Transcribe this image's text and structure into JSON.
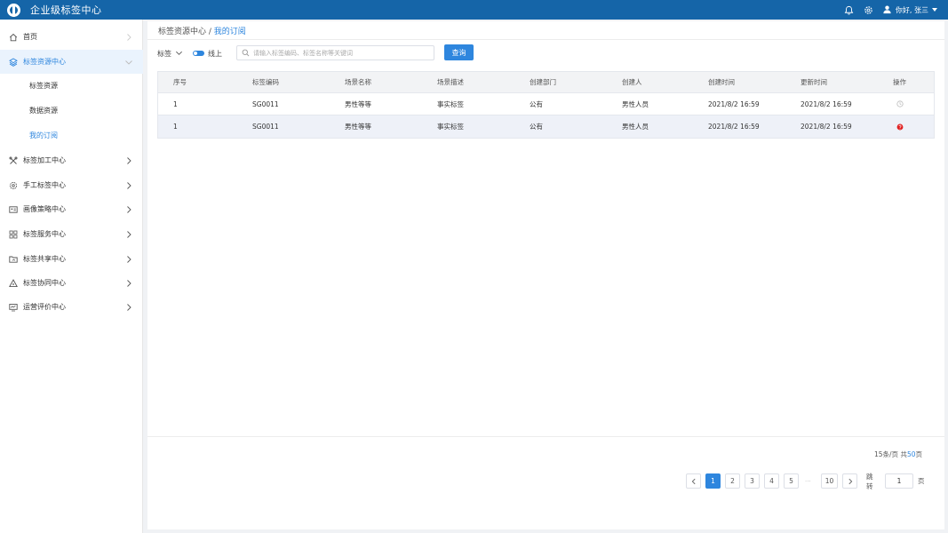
{
  "header": {
    "title": "企业级标签中心",
    "icons": [
      "logo-icon",
      "bell-icon",
      "gear-icon",
      "user-icon"
    ],
    "greeting": "你好, 张三"
  },
  "sidebar": {
    "items": [
      {
        "label": "首页",
        "icon": "home-icon"
      },
      {
        "label": "标签资源中心",
        "icon": "layers-icon",
        "expanded": true,
        "children": [
          {
            "label": "标签资源"
          },
          {
            "label": "数据资源"
          },
          {
            "label": "我的订阅",
            "current": true
          }
        ]
      },
      {
        "label": "标签加工中心",
        "icon": "tools-icon"
      },
      {
        "label": "手工标签中心",
        "icon": "gear-circle-icon"
      },
      {
        "label": "画像策略中心",
        "icon": "id-card-icon"
      },
      {
        "label": "标签服务中心",
        "icon": "grid-icon"
      },
      {
        "label": "标签共享中心",
        "icon": "folder-share-icon"
      },
      {
        "label": "标签协同中心",
        "icon": "triangle-icon"
      },
      {
        "label": "运营评价中心",
        "icon": "monitor-icon"
      }
    ]
  },
  "breadcrumb": {
    "parent": "标签资源中心",
    "sep": " / ",
    "current": "我的订阅"
  },
  "filter": {
    "select_value": "标签",
    "toggle_on": true,
    "toggle_label": "线上",
    "search_placeholder": "请输入标签编码、标签名称等关键词",
    "search_value": "",
    "query_button": "查询"
  },
  "table": {
    "columns": [
      "序号",
      "标签编码",
      "场景名称",
      "场景描述",
      "创建部门",
      "创建人",
      "创建时间",
      "更新时间",
      "操作"
    ],
    "rows": [
      {
        "cells": [
          "1",
          "SG0011",
          "男性等等",
          "事实标签",
          "公有",
          "男性人员",
          "2021/8/2 16:59",
          "2021/8/2 16:59"
        ],
        "op_icon": "clock-icon",
        "op_color": "#bbbbbb"
      },
      {
        "cells": [
          "1",
          "SG0011",
          "男性等等",
          "事实标签",
          "公有",
          "男性人员",
          "2021/8/2 16:59",
          "2021/8/2 16:59"
        ],
        "op_icon": "question-icon",
        "op_color": "#e02020"
      }
    ]
  },
  "pagination": {
    "per_page_text": "15条/页",
    "total_prefix": "共",
    "total_pages": "50",
    "total_suffix": "页",
    "pages": [
      "1",
      "2",
      "3",
      "4",
      "5"
    ],
    "ellipsis": "···",
    "last_page": "10",
    "current_page": "1",
    "jump_label": "跳转",
    "jump_value": "1",
    "jump_suffix": "页"
  },
  "colors": {
    "header_bg": "#1565a8",
    "accent": "#2e86de",
    "danger": "#e02020"
  }
}
